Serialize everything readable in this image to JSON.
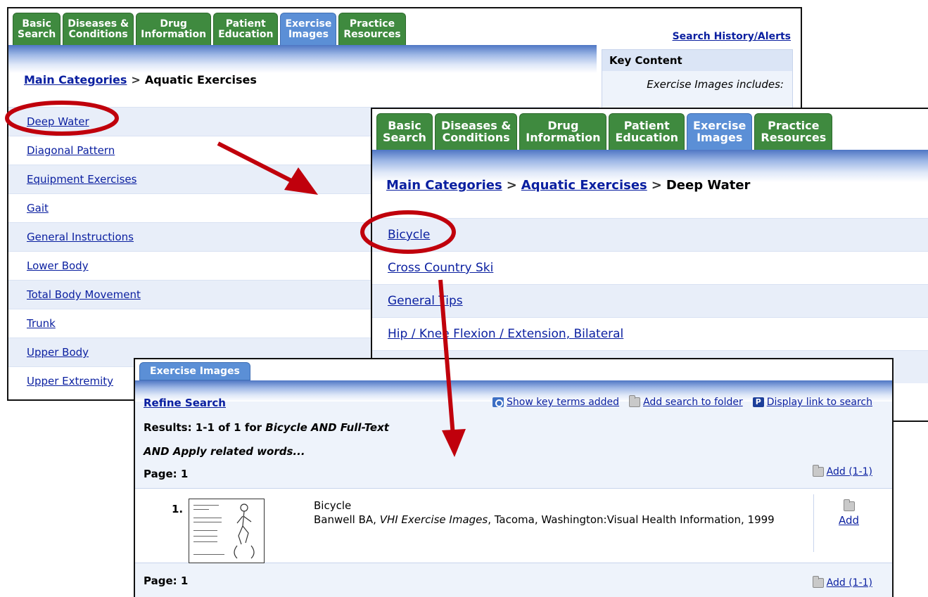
{
  "tabs": [
    {
      "line1": "Basic",
      "line2": "Search",
      "active": false
    },
    {
      "line1": "Diseases &",
      "line2": "Conditions",
      "active": false
    },
    {
      "line1": "Drug",
      "line2": "Information",
      "active": false
    },
    {
      "line1": "Patient",
      "line2": "Education",
      "active": false
    },
    {
      "line1": "Exercise",
      "line2": "Images",
      "active": true
    },
    {
      "line1": "Practice",
      "line2": "Resources",
      "active": false
    }
  ],
  "panel1": {
    "top_link": "Search History/Alerts",
    "breadcrumb": {
      "link": "Main Categories",
      "sep": ">",
      "current": "Aquatic Exercises"
    },
    "key_content": {
      "title": "Key Content",
      "text": "Exercise Images includes:"
    },
    "categories": [
      "Deep Water",
      "Diagonal Pattern",
      "Equipment Exercises",
      "Gait",
      "General Instructions",
      "Lower Body",
      "Total Body Movement",
      "Trunk",
      "Upper Body",
      "Upper Extremity"
    ]
  },
  "panel2": {
    "breadcrumb": {
      "link1": "Main Categories",
      "sep": ">",
      "link2": "Aquatic Exercises",
      "current": "Deep Water"
    },
    "items": [
      "Bicycle",
      "Cross Country Ski",
      "General Tips",
      "Hip / Knee Flexion / Extension, Bilateral"
    ]
  },
  "panel3": {
    "tab": "Exercise Images",
    "refine": "Refine Search",
    "tools": {
      "key_terms": "Show key terms added",
      "add_folder": "Add search to folder",
      "display_link": "Display link to search"
    },
    "results_label": "Results: 1-1 of 1 for",
    "query": "Bicycle AND Full-Text",
    "related": "AND Apply related words...",
    "page_label": "Page: 1",
    "add_range": "Add (1-1)",
    "result": {
      "number": "1.",
      "title": "Bicycle",
      "author": "Banwell BA,",
      "source": "VHI Exercise Images",
      "publisher": ", Tacoma, Washington:Visual Health Information, 1999",
      "add": "Add"
    }
  },
  "annotation_color": "#c0000c"
}
